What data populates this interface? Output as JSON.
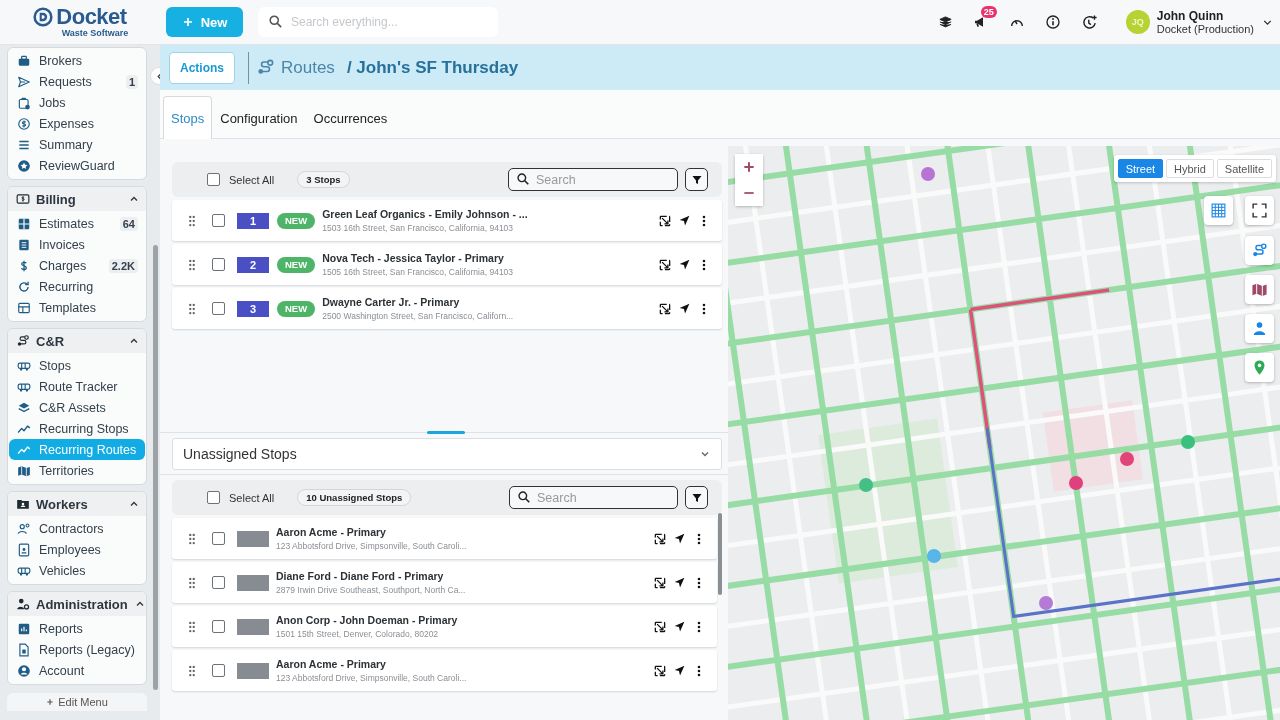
{
  "topbar": {
    "logo": {
      "name": "Docket",
      "tagline": "Waste Software"
    },
    "new_button": "New",
    "search": {
      "placeholder": "Search everything..."
    },
    "notifications": "25",
    "user": {
      "initials": "JQ",
      "name": "John Quinn",
      "org": "Docket (Production)"
    }
  },
  "sidebar": {
    "groups": [
      {
        "items": [
          {
            "label": "Brokers",
            "selected": false
          },
          {
            "label": "Requests",
            "badge": "1",
            "selected": false
          },
          {
            "label": "Jobs",
            "selected": false
          },
          {
            "label": "Expenses",
            "selected": false
          },
          {
            "label": "Summary",
            "selected": false
          },
          {
            "label": "ReviewGuard",
            "selected": false
          }
        ]
      },
      {
        "title": "Billing",
        "expanded": true,
        "items": [
          {
            "label": "Estimates",
            "badge": "64",
            "selected": false
          },
          {
            "label": "Invoices",
            "selected": false
          },
          {
            "label": "Charges",
            "badge": "2.2K",
            "selected": false
          },
          {
            "label": "Recurring",
            "selected": false
          },
          {
            "label": "Templates",
            "selected": false
          }
        ]
      },
      {
        "title": "C&R",
        "expanded": true,
        "items": [
          {
            "label": "Stops",
            "selected": false
          },
          {
            "label": "Route Tracker",
            "selected": false
          },
          {
            "label": "C&R Assets",
            "selected": false
          },
          {
            "label": "Recurring Stops",
            "selected": false
          },
          {
            "label": "Recurring Routes",
            "selected": true
          },
          {
            "label": "Territories",
            "selected": false
          }
        ]
      },
      {
        "title": "Workers",
        "expanded": true,
        "items": [
          {
            "label": "Contractors",
            "selected": false
          },
          {
            "label": "Employees",
            "selected": false
          },
          {
            "label": "Vehicles",
            "selected": false
          }
        ]
      },
      {
        "title": "Administration",
        "expanded": true,
        "items": [
          {
            "label": "Reports",
            "selected": false
          },
          {
            "label": "Reports (Legacy)",
            "selected": false
          },
          {
            "label": "Account",
            "selected": false
          }
        ]
      }
    ],
    "edit_menu": "Edit Menu"
  },
  "page_header": {
    "actions": "Actions",
    "section": "Routes",
    "title": "/ John's SF Thursday"
  },
  "tabs": [
    {
      "label": "Stops",
      "selected": true
    },
    {
      "label": "Configuration",
      "selected": false
    },
    {
      "label": "Occurrences",
      "selected": false
    }
  ],
  "assigned": {
    "select_all": {
      "label": "Select All",
      "checked": false
    },
    "count": "3 Stops",
    "search": {
      "placeholder": "Search"
    },
    "stops": [
      {
        "number": "1",
        "status": "NEW",
        "title": "Green Leaf Organics - Emily Johnson - ...",
        "address": "1503 16th Street, San Francisco, California, 94103",
        "checked": false
      },
      {
        "number": "2",
        "status": "NEW",
        "title": "Nova Tech - Jessica Taylor - Primary",
        "address": "1505 16th Street, San Francisco, California, 94103",
        "checked": false
      },
      {
        "number": "3",
        "status": "NEW",
        "title": "Dwayne Carter Jr. - Primary",
        "address": "2500 Washington Street, San Francisco, Californ...",
        "checked": false
      }
    ]
  },
  "unassigned": {
    "dropdown": "Unassigned Stops",
    "select_all": {
      "label": "Select All",
      "checked": false
    },
    "count": "10 Unassigned Stops",
    "search": {
      "placeholder": "Search"
    },
    "stops": [
      {
        "title": "Aaron Acme - Primary",
        "address": "123 Abbotsford Drive, Simpsonville, South Caroli...",
        "checked": false
      },
      {
        "title": "Diane Ford - Diane Ford - Primary",
        "address": "2879 Irwin Drive Southeast, Southport, North Ca...",
        "checked": false
      },
      {
        "title": "Anon Corp - John Doeman - Primary",
        "address": "1501 15th Street, Denver, Colorado, 80202",
        "checked": false
      },
      {
        "title": "Aaron Acme - Primary",
        "address": "123 Abbotsford Drive, Simpsonville, South Caroli...",
        "checked": false
      }
    ]
  },
  "map": {
    "map_types": [
      {
        "label": "Street",
        "selected": true
      },
      {
        "label": "Hybrid",
        "selected": false
      },
      {
        "label": "Satellite",
        "selected": false
      }
    ]
  }
}
